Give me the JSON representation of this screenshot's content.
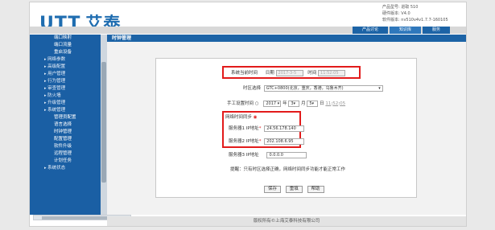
{
  "header": {
    "logo_brand": "UTT",
    "logo_cn": "艾泰",
    "info_lines": [
      "产品型号: 进取 510",
      "硬件版本: V4.0",
      "软件版本: nv510v4v1.7.7-160105"
    ]
  },
  "topnav": [
    "产品讨论",
    "知识库",
    "服务"
  ],
  "sidebar": {
    "items": [
      {
        "label": "端口映射",
        "kind": "sub"
      },
      {
        "label": "端口流量",
        "kind": "sub"
      },
      {
        "label": "重启设备",
        "kind": "sub"
      },
      {
        "label": "网络参数",
        "kind": "grp"
      },
      {
        "label": "高级配置",
        "kind": "grp"
      },
      {
        "label": "用户管理",
        "kind": "grp"
      },
      {
        "label": "行为管理",
        "kind": "grp"
      },
      {
        "label": "审查管理",
        "kind": "grp"
      },
      {
        "label": "防火墙",
        "kind": "grp"
      },
      {
        "label": "升级管理",
        "kind": "grp"
      },
      {
        "label": "系统管理",
        "kind": "grp"
      },
      {
        "label": "管理员配置",
        "kind": "sub"
      },
      {
        "label": "语言选择",
        "kind": "sub"
      },
      {
        "label": "时钟管理",
        "kind": "sub"
      },
      {
        "label": "配置管理",
        "kind": "sub"
      },
      {
        "label": "软件升级",
        "kind": "sub"
      },
      {
        "label": "远程管理",
        "kind": "sub"
      },
      {
        "label": "计划任务",
        "kind": "sub"
      },
      {
        "label": "系统状态",
        "kind": "grp"
      }
    ]
  },
  "title_bar": {
    "title": "时钟管理",
    "right": ""
  },
  "form": {
    "system_time_label": "系统当前时间",
    "date_label": "日期",
    "date_value": "2017-3-5",
    "time_label": "时间",
    "time_value": "11:52:05",
    "timezone_label": "时区选择",
    "timezone_value": "GTC+0800(北京，重庆，香港，乌鲁木齐)",
    "manual_label": "手工设置时间",
    "manual_year": "2017",
    "year_unit": "年",
    "manual_month": "3",
    "month_unit": "月",
    "manual_day": "5",
    "day_unit": "日",
    "manual_h": "11",
    "manual_m": "52",
    "manual_s": "05",
    "ntp_label": "网络时间同步",
    "server1_label": "服务器1 IP地址",
    "server1_value": "24.56.178.140",
    "server2_label": "服务器2 IP地址",
    "server2_value": "202.108.6.95",
    "server3_label": "服务器3 IP地址",
    "server3_value": "0.0.0.0",
    "note": "提醒：只有时区选择正确，网络时间同步功能才能正常工作",
    "btn_save": "保存",
    "btn_reset": "重填",
    "btn_help": "帮助"
  },
  "footer": "版权所有©上海艾泰科技有限公司",
  "colors": {
    "accent": "#1c63a6",
    "highlight": "#e21b1b"
  }
}
